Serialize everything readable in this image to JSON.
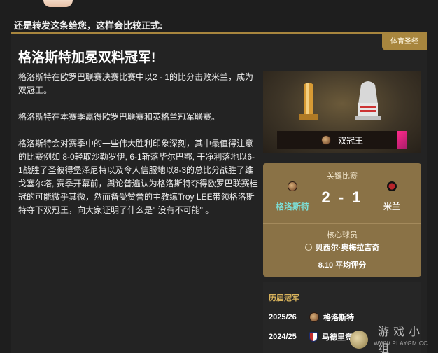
{
  "intro_text": "还是转发这条给您，这样会比较正式:",
  "card": {
    "tag": "体育圣经",
    "headline": "格洛斯特加冕双料冠军!",
    "paragraphs": [
      "格洛斯特在欧罗巴联赛决赛比赛中以2 - 1的比分击败米兰，成为双冠王。",
      "格洛斯特在本赛季赢得欧罗巴联赛和英格兰冠军联赛。",
      "格洛斯特会对赛季中的一些伟大胜利印象深刻，其中最值得注意的比赛例如 8-0轻取沙勒罗伊, 6-1斩落毕尔巴鄂, 干净利落地以6-1战胜了圣彼得堡泽尼特以及令人信服地以8-3的总比分战胜了维戈塞尔塔, 赛季开幕前，舆论普遍认为格洛斯特夺得欧罗巴联赛桂冠的可能微乎其微，然而备受赞誉的主教练Troy LEE带领格洛斯特夺下双冠王，向大家证明了什么是\" 没有不可能\" 。"
    ]
  },
  "trophy": {
    "banner_label": "双冠王",
    "cup_color": "#e0a640",
    "accent_color": "#ff2a8a"
  },
  "key_match": {
    "label": "关键比赛",
    "home_team": "格洛斯特",
    "away_team": "米兰",
    "score": "2 - 1",
    "player_label": "核心球员",
    "player_name": "贝西尔·奥梅拉吉奇",
    "rating": "8.10 平均评分"
  },
  "history": {
    "title": "历届冠军",
    "rows": [
      {
        "year": "2025/26",
        "team": "格洛斯特",
        "icon": "gloucester-crest-icon"
      },
      {
        "year": "2024/25",
        "team": "马德里竞技",
        "icon": "atletico-crest-icon"
      }
    ]
  },
  "watermark": {
    "cn": "游戏小组",
    "url": "WWW.PLAYGM.CC"
  },
  "colors": {
    "gold": "#a8863e",
    "panel": "#8a7246",
    "teal": "#7ce0d8"
  }
}
